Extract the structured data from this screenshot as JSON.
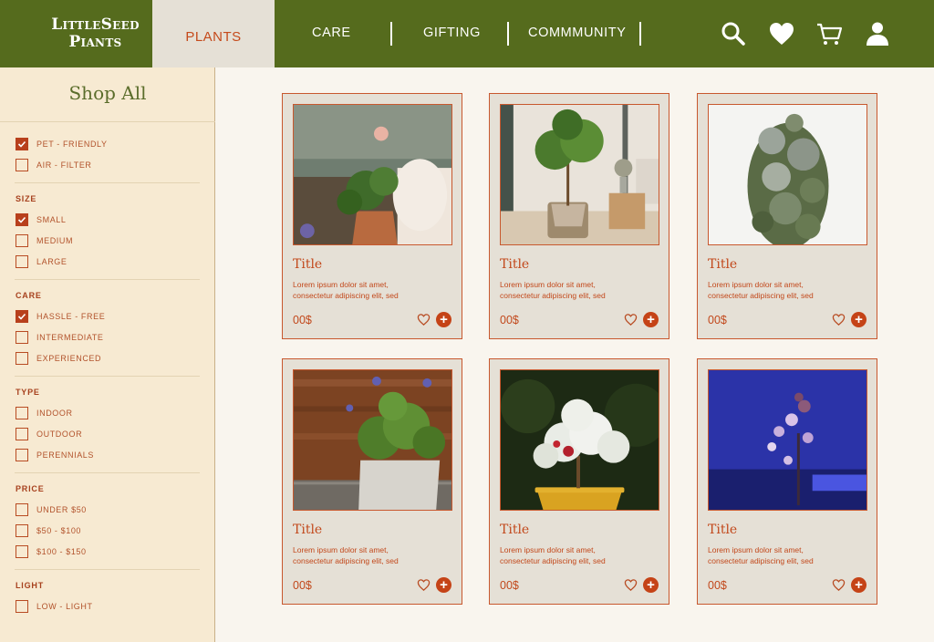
{
  "brand": {
    "line1": "LittleSeed",
    "line2": "Piants"
  },
  "nav": {
    "active": "PLANTS",
    "items": [
      "CARE",
      "GIFTING",
      "COMMMUNITY"
    ]
  },
  "header_icons": [
    "search-icon",
    "heart-icon",
    "cart-icon",
    "user-icon"
  ],
  "colors": {
    "header": "#556b1d",
    "accent": "#c54317",
    "sidebar": "#f7ead2",
    "card": "#e5e0d6"
  },
  "sidebar": {
    "title": "Shop All",
    "features": [
      {
        "label": "PET - FRIENDLY",
        "checked": true
      },
      {
        "label": "AIR - FILTER",
        "checked": false
      }
    ],
    "size": {
      "heading": "SIZE",
      "options": [
        {
          "label": "SMALL",
          "checked": true
        },
        {
          "label": "MEDIUM",
          "checked": false
        },
        {
          "label": "LARGE",
          "checked": false
        }
      ]
    },
    "care": {
      "heading": "CARE",
      "options": [
        {
          "label": "HASSLE - FREE",
          "checked": true
        },
        {
          "label": "INTERMEDIATE",
          "checked": false
        },
        {
          "label": "EXPERIENCED",
          "checked": false
        }
      ]
    },
    "type": {
      "heading": "TYPE",
      "options": [
        {
          "label": "INDOOR",
          "checked": false
        },
        {
          "label": "OUTDOOR",
          "checked": false
        },
        {
          "label": "PERENNIALS",
          "checked": false
        }
      ]
    },
    "price": {
      "heading": "PRICE",
      "options": [
        {
          "label": "UNDER $50",
          "checked": false
        },
        {
          "label": "$50 - $100",
          "checked": false
        },
        {
          "label": "$100 - $150",
          "checked": false
        }
      ]
    },
    "light": {
      "heading": "LIGHT",
      "options": [
        {
          "label": "LOW - LIGHT",
          "checked": false
        }
      ]
    }
  },
  "products": [
    {
      "title": "Title",
      "desc_line1": "Lorem ipsum dolor sit amet,",
      "desc_line2": "consectetur adipiscing elit, sed",
      "price": "00$"
    },
    {
      "title": "Title",
      "desc_line1": "Lorem ipsum dolor sit amet,",
      "desc_line2": "consectetur adipiscing elit, sed",
      "price": "00$"
    },
    {
      "title": "Title",
      "desc_line1": "Lorem ipsum dolor sit amet,",
      "desc_line2": "consectetur adipiscing elit, sed",
      "price": "00$"
    },
    {
      "title": "Title",
      "desc_line1": "Lorem ipsum dolor sit amet,",
      "desc_line2": "consectetur adipiscing elit, sed",
      "price": "00$"
    },
    {
      "title": "Title",
      "desc_line1": "Lorem ipsum dolor sit amet,",
      "desc_line2": "consectetur adipiscing elit, sed",
      "price": "00$"
    },
    {
      "title": "Title",
      "desc_line1": "Lorem ipsum dolor sit amet,",
      "desc_line2": "consectetur adipiscing elit, sed",
      "price": "00$"
    }
  ]
}
